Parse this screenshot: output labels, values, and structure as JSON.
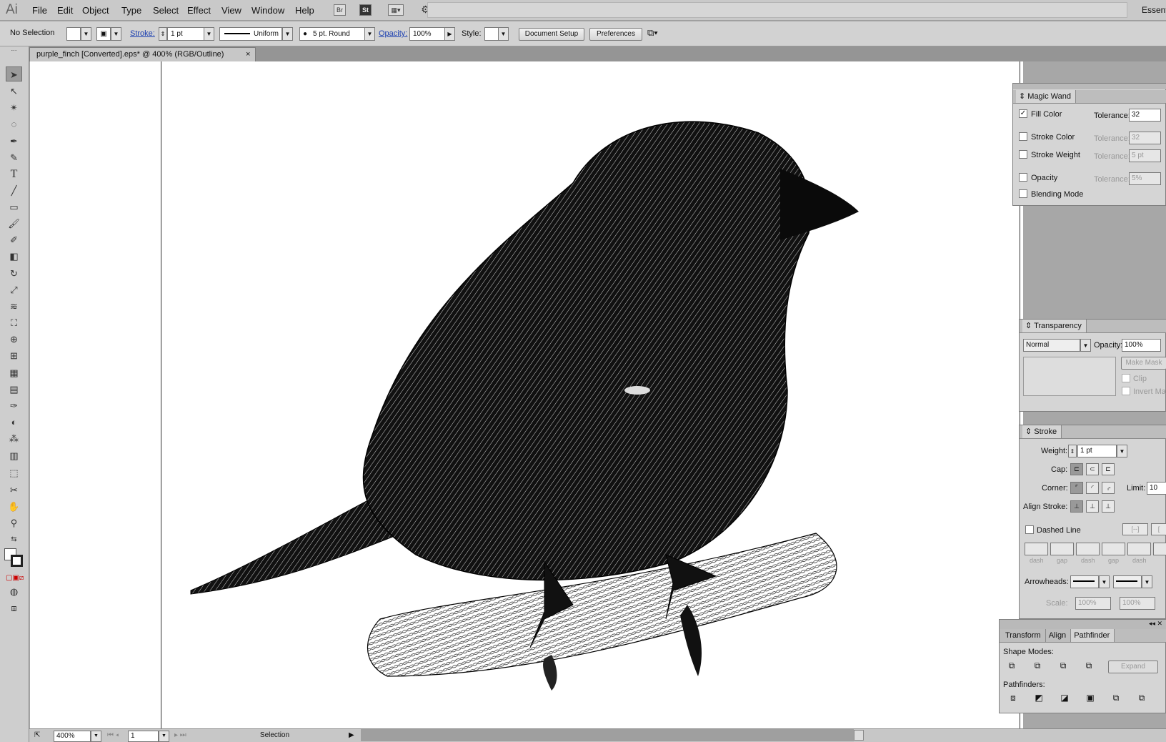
{
  "app": {
    "logo": "Ai",
    "workspace": "Essent"
  },
  "menu": [
    "File",
    "Edit",
    "Object",
    "Type",
    "Select",
    "Effect",
    "View",
    "Window",
    "Help"
  ],
  "menubar_icons": {
    "bridge": "Br",
    "stock": "St"
  },
  "control": {
    "selection": "No Selection",
    "stroke_label": "Stroke:",
    "stroke_value": "1 pt",
    "profile": "Uniform",
    "brush": "5 pt. Round",
    "opacity_label": "Opacity:",
    "opacity_value": "100%",
    "style_label": "Style:",
    "document_setup": "Document Setup",
    "preferences": "Preferences"
  },
  "document_tab": {
    "title": "purple_finch [Converted].eps* @ 400% (RGB/Outline)",
    "close": "×"
  },
  "magic_wand": {
    "title": "Magic Wand",
    "fill_color": "Fill Color",
    "stroke_color": "Stroke Color",
    "stroke_weight": "Stroke Weight",
    "opacity": "Opacity",
    "blending_mode": "Blending Mode",
    "tolerance_label": "Tolerance:",
    "fill_tol": "32",
    "stroke_tol": "32",
    "weight_tol": "5 pt",
    "opacity_tol": "5%"
  },
  "transparency": {
    "title": "Transparency",
    "mode": "Normal",
    "opacity_label": "Opacity:",
    "opacity_value": "100%",
    "make_mask": "Make Mask",
    "clip": "Clip",
    "invert": "Invert Mask"
  },
  "stroke_panel": {
    "title": "Stroke",
    "weight_label": "Weight:",
    "weight_value": "1 pt",
    "cap_label": "Cap:",
    "corner_label": "Corner:",
    "limit_label": "Limit:",
    "limit_value": "10",
    "align_label": "Align Stroke:",
    "dashed_line": "Dashed Line",
    "dash": "dash",
    "gap": "gap",
    "arrowheads_label": "Arrowheads:",
    "scale_label": "Scale:",
    "scale_1": "100%",
    "scale_2": "100%"
  },
  "pathfinder": {
    "tabs": [
      "Transform",
      "Align",
      "Pathfinder"
    ],
    "shape_modes": "Shape Modes:",
    "expand": "Expand",
    "pathfinders": "Pathfinders:"
  },
  "status": {
    "zoom": "400%",
    "page": "1",
    "tool": "Selection"
  }
}
